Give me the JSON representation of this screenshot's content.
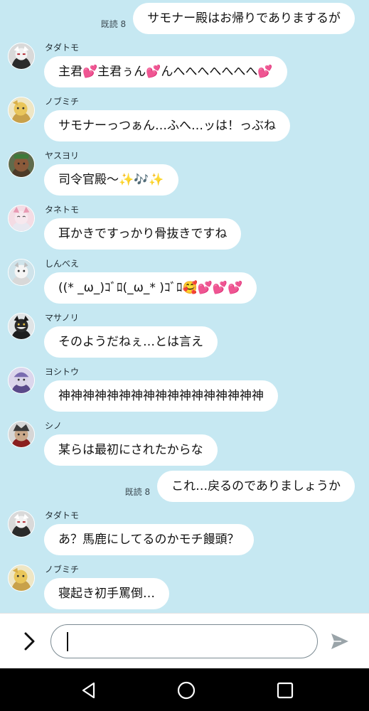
{
  "read_label": "既読 8",
  "outgoing": [
    {
      "text": "サモナー殿はお帰りでありまするが"
    },
    {
      "text": "これ…戻るのでありましょうか"
    }
  ],
  "messages": [
    {
      "sender": "タダトモ",
      "parts": [
        "主君",
        "💕",
        "主君ぅん",
        "💕",
        "んへへへへへへへ",
        "💕"
      ]
    },
    {
      "sender": "ノブミチ",
      "parts": [
        "サモナーっつぁん…ふへ…ッは！っぶね"
      ]
    },
    {
      "sender": "ヤスヨリ",
      "parts": [
        "司令官殿〜✨🎶✨"
      ]
    },
    {
      "sender": "タネトモ",
      "parts": [
        "耳かきですっかり骨抜きですね"
      ]
    },
    {
      "sender": "しんべえ",
      "parts": [
        "((* _ω_)ｺﾞﾛ(_ω_* )ｺﾞﾛ🥰💕💕💕"
      ]
    },
    {
      "sender": "マサノリ",
      "parts": [
        "そのようだねぇ…とは言え"
      ]
    },
    {
      "sender": "ヨシトウ",
      "parts": [
        "神神神神神神神神神神神神神神神神神"
      ]
    },
    {
      "sender": "シノ",
      "parts": [
        "某らは最初にされたからな"
      ]
    },
    {
      "sender": "タダトモ",
      "parts": [
        "あ？馬鹿にしてるのかモチ饅頭？"
      ]
    },
    {
      "sender": "ノブミチ",
      "parts": [
        "寝起き初手罵倒…"
      ]
    }
  ],
  "input": {
    "value": ""
  },
  "colors": {
    "background": "#c6e8f2",
    "bubble": "#ffffff",
    "heart": "#e0245e"
  }
}
